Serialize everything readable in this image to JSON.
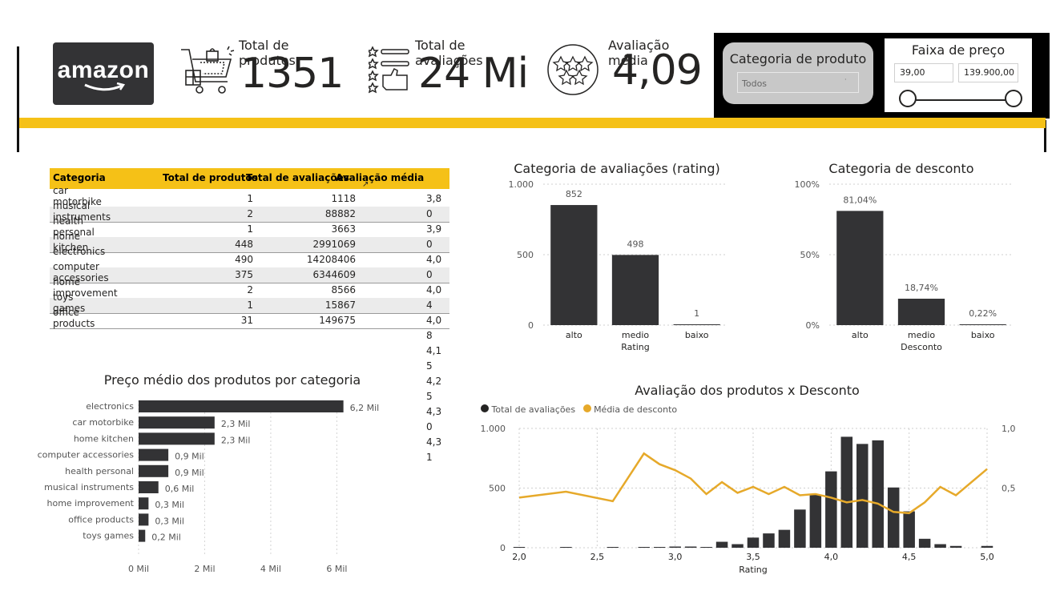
{
  "logo": {
    "text": "amazon"
  },
  "kpis": [
    {
      "label": "Total de produtos",
      "value": "1351",
      "icon": "shopping-cart-icon"
    },
    {
      "label": "Total de avaliações",
      "value": "24 Mi",
      "icon": "rating-list-icon"
    },
    {
      "label": "Avaliação média",
      "value": "4,09",
      "icon": "stars-icon"
    }
  ],
  "category_slicer": {
    "title": "Categoria de produto",
    "value": "Todos"
  },
  "price_slicer": {
    "title": "Faixa de preço",
    "min": "39,00",
    "max": "139.900,00"
  },
  "table": {
    "headers": [
      "Categoria",
      "Total de produtos",
      "Total de avaliações",
      "Avaliação média"
    ],
    "categories": [
      "car motorbike",
      "musical instruments",
      "health personal",
      "home kitchen",
      "electronics",
      "computer accessories",
      "home improvement",
      "toys games",
      "office products"
    ],
    "products": [
      "1",
      "2",
      "1",
      "448",
      "490",
      "375",
      "2",
      "1",
      "31"
    ],
    "reviews": [
      "1118",
      "88882",
      "3663",
      "2991069",
      "14208406",
      "6344609",
      "8566",
      "15867",
      "149675"
    ],
    "ratings": [
      "3,8",
      "0",
      "3,9",
      "0",
      "4,0",
      "0",
      "4,0",
      "4",
      "4,0",
      "8",
      "4,1",
      "5",
      "4,2",
      "5",
      "4,3",
      "0",
      "4,3",
      "1"
    ]
  },
  "colors": {
    "accent": "#F5C117",
    "bar": "#333335",
    "line": "#E6A92A",
    "dark": "#000000"
  },
  "chart_data": [
    {
      "type": "bar",
      "title": "Categoria de avaliações (rating)",
      "xlabel": "Rating",
      "categories": [
        "alto",
        "medio",
        "baixo"
      ],
      "values": [
        852,
        498,
        1
      ],
      "labels": [
        "852",
        "498",
        "1"
      ],
      "yticks": [
        "0",
        "500",
        "1.000"
      ],
      "ylim": [
        0,
        1000
      ]
    },
    {
      "type": "bar",
      "title": "Categoria de desconto",
      "xlabel": "Desconto",
      "categories": [
        "alto",
        "medio",
        "baixo"
      ],
      "values": [
        81.04,
        18.74,
        0.22
      ],
      "labels": [
        "81,04%",
        "18,74%",
        "0,22%"
      ],
      "yticks": [
        "0%",
        "50%",
        "100%"
      ],
      "ylim": [
        0,
        100
      ]
    },
    {
      "type": "bar",
      "title": "Preço médio dos produtos por categoria",
      "categories": [
        "electronics",
        "car motorbike",
        "home kitchen",
        "computer accessories",
        "health personal",
        "musical instruments",
        "home improvement",
        "office products",
        "toys games"
      ],
      "values": [
        6200,
        2300,
        2300,
        900,
        900,
        600,
        300,
        300,
        200
      ],
      "labels": [
        "6,2 Mil",
        "2,3  Mil",
        "2,3 Mil",
        "0,9 Mil",
        "0,9 Mil",
        "0,6 Mil",
        "0,3 Mil",
        "0,3 Mil",
        "0,2 Mil"
      ],
      "xticks": [
        "0 Mil",
        "2 Mil",
        "4 Mil",
        "6 Mil"
      ],
      "xlim": [
        0,
        7000
      ]
    },
    {
      "type": "bar",
      "title": "Avaliação dos produtos x Desconto",
      "xlabel": "Rating",
      "legend": [
        "Total de avaliações",
        "Média de desconto"
      ],
      "xticks": [
        "2,0",
        "2,5",
        "3,0",
        "3,5",
        "4,0",
        "4,5",
        "5,0"
      ],
      "yticks_left": [
        "0",
        "500",
        "1.000"
      ],
      "yticks_right": [
        "0,5",
        "1,0"
      ],
      "x": [
        2.0,
        2.3,
        2.6,
        2.8,
        2.9,
        3.0,
        3.1,
        3.2,
        3.3,
        3.4,
        3.5,
        3.6,
        3.7,
        3.8,
        3.9,
        4.0,
        4.1,
        4.2,
        4.3,
        4.4,
        4.5,
        4.6,
        4.7,
        4.8,
        5.0
      ],
      "series": [
        {
          "name": "Total de avaliações",
          "values": [
            1,
            1,
            1,
            5,
            5,
            10,
            10,
            5,
            50,
            30,
            85,
            120,
            150,
            320,
            445,
            640,
            930,
            870,
            900,
            505,
            305,
            75,
            30,
            15,
            15
          ]
        },
        {
          "name": "Média de desconto",
          "values": [
            0.42,
            0.47,
            0.39,
            0.79,
            0.7,
            0.65,
            0.58,
            0.45,
            0.55,
            0.46,
            0.51,
            0.45,
            0.51,
            0.44,
            0.45,
            0.42,
            0.38,
            0.4,
            0.37,
            0.3,
            0.29,
            0.38,
            0.51,
            0.44,
            0.66
          ]
        }
      ],
      "ylim": [
        0,
        1000
      ],
      "y2lim": [
        0,
        1.0
      ]
    }
  ]
}
